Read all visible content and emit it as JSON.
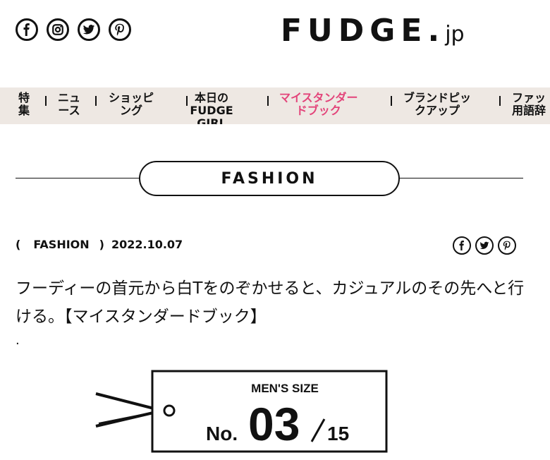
{
  "header": {
    "logo_main": "FUDGE.",
    "logo_suffix": "jp",
    "social_icons": [
      "facebook-icon",
      "instagram-icon",
      "twitter-icon",
      "pinterest-icon"
    ]
  },
  "nav": {
    "items": [
      {
        "label": "特\n集",
        "active": false
      },
      {
        "label": "ニュ\nース",
        "active": false
      },
      {
        "label": "ショッピ\nング",
        "active": false
      },
      {
        "label": "本日の\nFUDGE GIRL",
        "active": false
      },
      {
        "label": "マイスタンダー\nドブック",
        "active": true
      },
      {
        "label": "ブランドピッ\nクアップ",
        "active": false
      },
      {
        "label": "ファッ\n用語辞",
        "active": false
      }
    ],
    "active_color": "#e3447a",
    "background": "#eee8e3"
  },
  "section": {
    "heading": "FASHION"
  },
  "article": {
    "open_paren": "(",
    "category": "FASHION",
    "close_paren": ")",
    "date": "2022.10.07",
    "share_icons": [
      "facebook-icon",
      "twitter-icon",
      "pinterest-icon"
    ],
    "title": "フーディーの首元から白Tをのぞかせると、カジュアルのその先へと行ける。【マイスタンダードブック】",
    "dot": "."
  },
  "tag": {
    "label": "MEN'S SIZE",
    "prefix": "No.",
    "number": "03",
    "total": "15"
  }
}
